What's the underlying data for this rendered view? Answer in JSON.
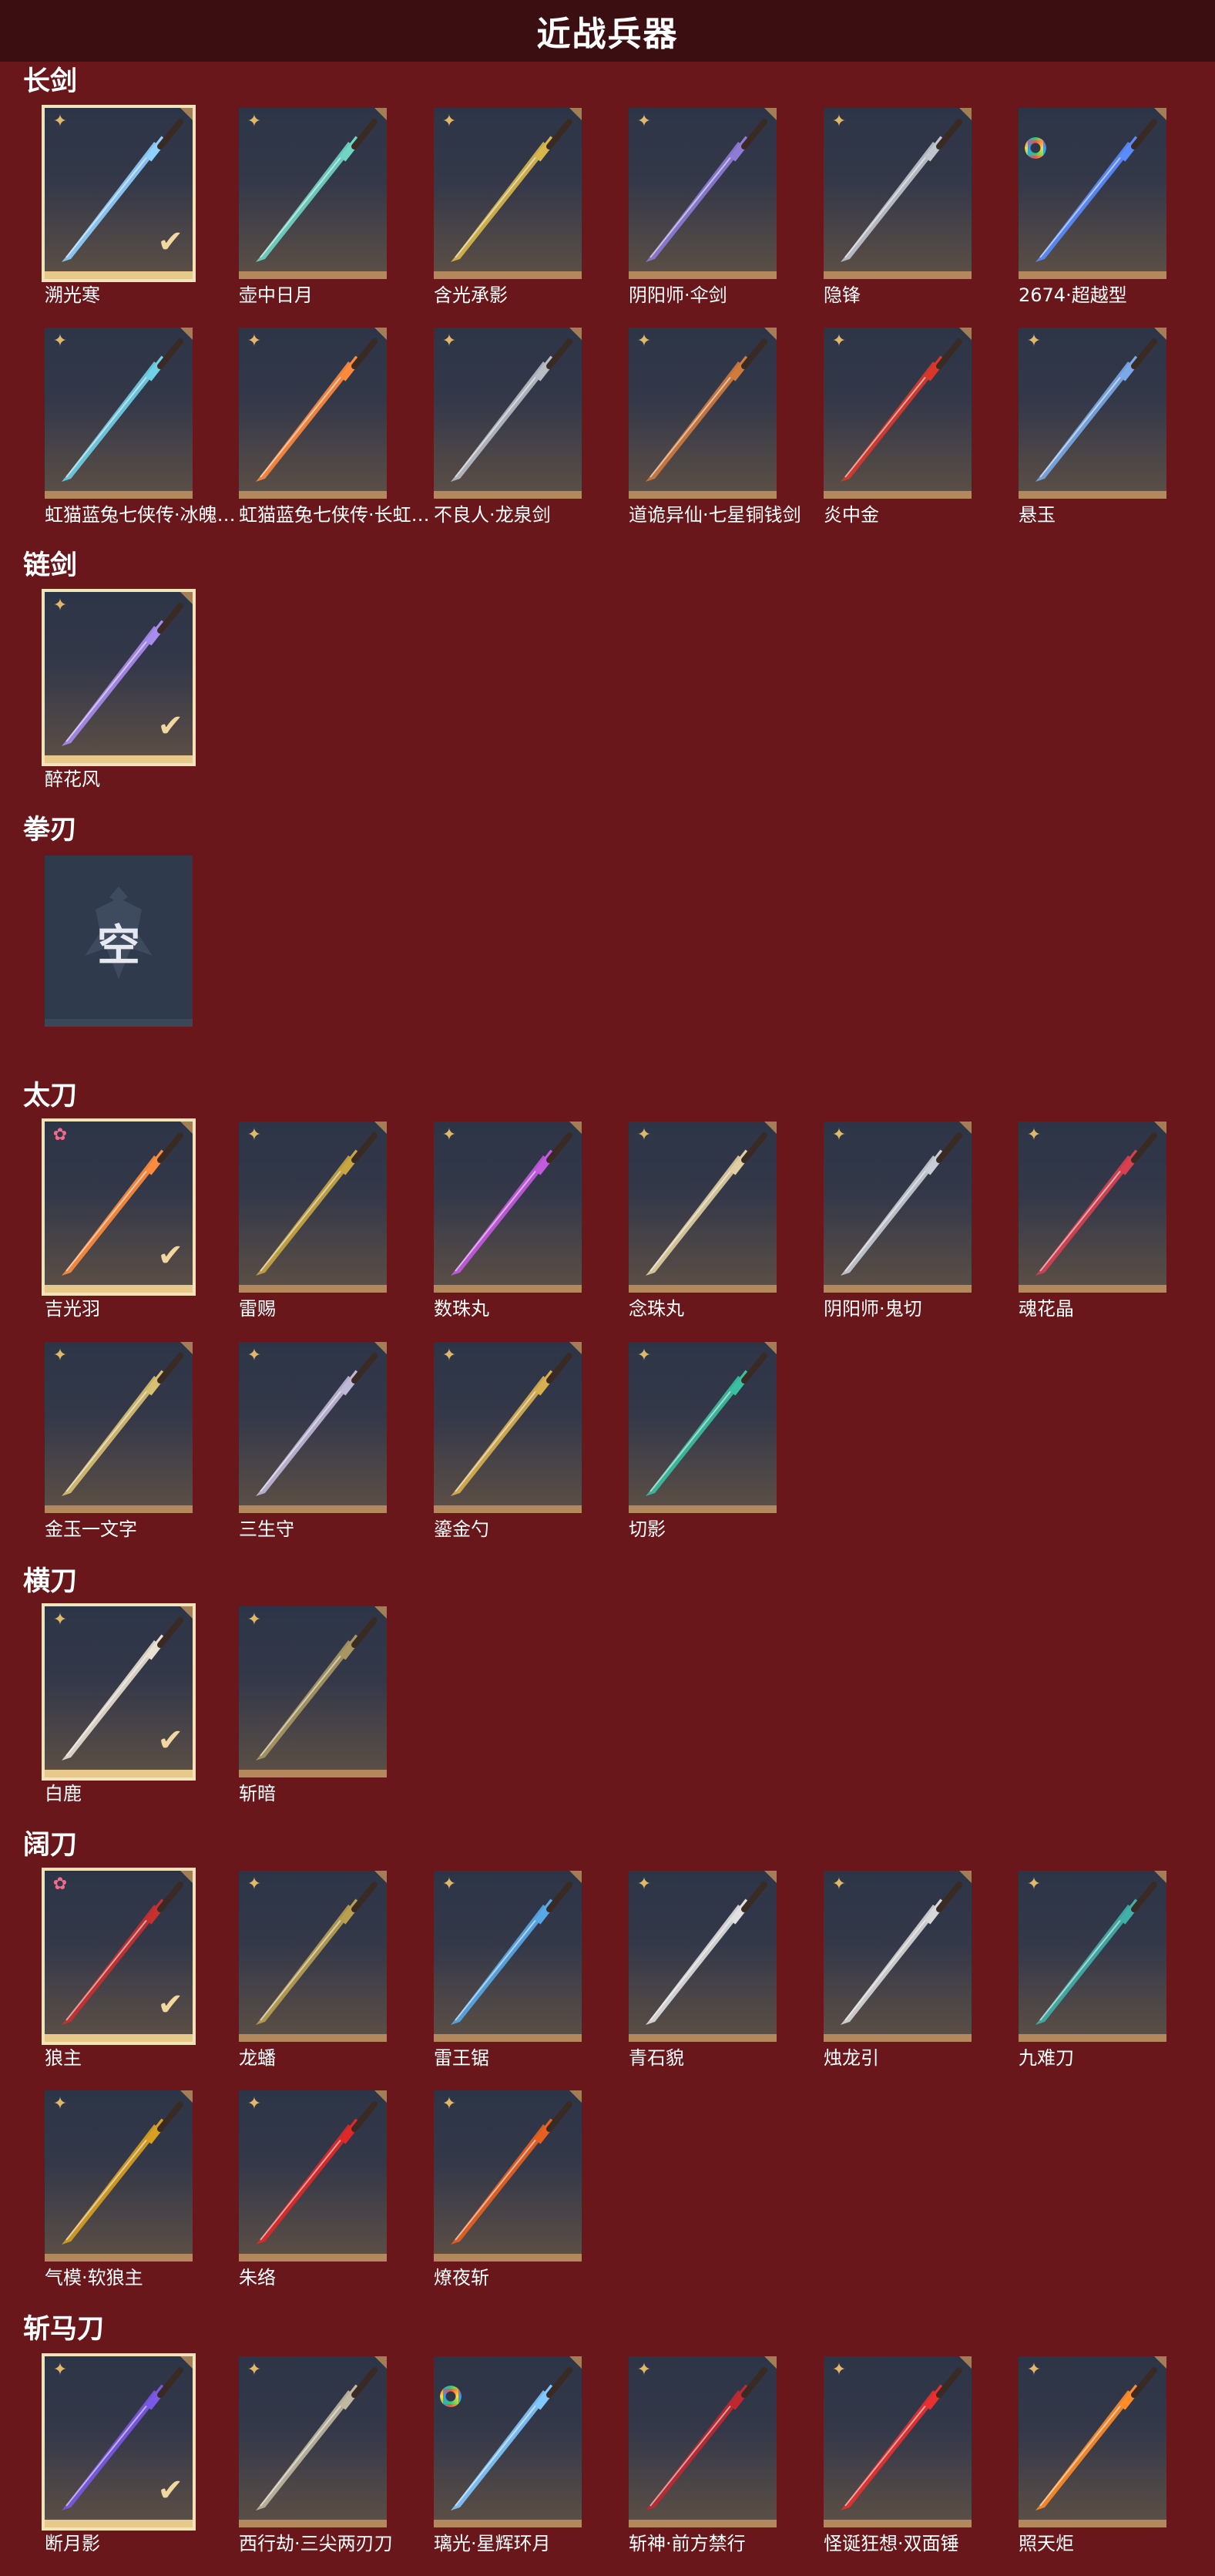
{
  "title": "近战兵器",
  "colors": {
    "background": "#6a171b",
    "title_bar": "#3b0e12",
    "tile_border": "#b3885c",
    "selected_border": "#f3e3b8"
  },
  "sections": [
    {
      "id": "changjian",
      "title": "长剑",
      "items": [
        {
          "label": "溯光寒",
          "badge": "gold-star-icon",
          "selected": true,
          "color": "#8fd0ff"
        },
        {
          "label": "壶中日月",
          "badge": "gold-star-icon",
          "selected": false,
          "color": "#6fd6c4"
        },
        {
          "label": "含光承影",
          "badge": "gold-star-icon",
          "selected": false,
          "color": "#d8b84a"
        },
        {
          "label": "阴阳师·伞剑",
          "badge": "gold-star-icon",
          "selected": false,
          "color": "#8d7bd6"
        },
        {
          "label": "隐锋",
          "badge": "gold-star-icon",
          "selected": false,
          "color": "#c0c4cc"
        },
        {
          "label": "2674·超越型",
          "badge": "rainbow-ring-icon",
          "selected": false,
          "color": "#5a8cff"
        },
        {
          "label": "虹猫蓝兔七侠传·冰魄…",
          "badge": "gold-star-icon",
          "selected": false,
          "color": "#6fd0e8"
        },
        {
          "label": "虹猫蓝兔七侠传·长虹…",
          "badge": "gold-star-icon",
          "selected": false,
          "color": "#ff8a3c"
        },
        {
          "label": "不良人·龙泉剑",
          "badge": "gold-star-icon",
          "selected": false,
          "color": "#b8bcc4"
        },
        {
          "label": "道诡异仙·七星铜钱剑",
          "badge": "gold-star-icon",
          "selected": false,
          "color": "#d07a3c"
        },
        {
          "label": "炎中金",
          "badge": "gold-star-icon",
          "selected": false,
          "color": "#d8382c"
        },
        {
          "label": "悬玉",
          "badge": "gold-star-icon",
          "selected": false,
          "color": "#7aa8e8"
        }
      ]
    },
    {
      "id": "lianjian",
      "title": "链剑",
      "items": [
        {
          "label": "醉花风",
          "badge": "gold-star-icon",
          "selected": true,
          "color": "#a88cf0"
        }
      ]
    },
    {
      "id": "quanren",
      "title": "拳刃",
      "items": [],
      "empty_text": "空"
    },
    {
      "id": "taidao",
      "title": "太刀",
      "items": [
        {
          "label": "吉光羽",
          "badge": "pink-star-icon",
          "selected": true,
          "color": "#ff8c3c"
        },
        {
          "label": "雷赐",
          "badge": "gold-star-icon",
          "selected": false,
          "color": "#c8a640"
        },
        {
          "label": "数珠丸",
          "badge": "gold-star-icon",
          "selected": false,
          "color": "#c45ae0"
        },
        {
          "label": "念珠丸",
          "badge": "gold-star-icon",
          "selected": false,
          "color": "#e0cfa0"
        },
        {
          "label": "阴阳师·鬼切",
          "badge": "gold-star-icon",
          "selected": false,
          "color": "#c8ccd4"
        },
        {
          "label": "魂花晶",
          "badge": "gold-star-icon",
          "selected": false,
          "color": "#d84050"
        },
        {
          "label": "金玉一文字",
          "badge": "gold-star-icon",
          "selected": false,
          "color": "#d8c070"
        },
        {
          "label": "三生守",
          "badge": "gold-star-icon",
          "selected": false,
          "color": "#c0b8d8"
        },
        {
          "label": "鎏金勺",
          "badge": "gold-star-icon",
          "selected": false,
          "color": "#d8b050"
        },
        {
          "label": "切影",
          "badge": "gold-star-icon",
          "selected": false,
          "color": "#3ac0a0"
        }
      ]
    },
    {
      "id": "hengdao",
      "title": "横刀",
      "items": [
        {
          "label": "白鹿",
          "badge": "gold-star-icon",
          "selected": true,
          "color": "#e8e0d0"
        },
        {
          "label": "斩暗",
          "badge": "gold-star-icon",
          "selected": false,
          "color": "#a89860"
        }
      ]
    },
    {
      "id": "kuodao",
      "title": "阔刀",
      "items": [
        {
          "label": "狼主",
          "badge": "pink-star-icon",
          "selected": true,
          "color": "#c83030"
        },
        {
          "label": "龙蟠",
          "badge": "gold-star-icon",
          "selected": false,
          "color": "#b8a050"
        },
        {
          "label": "雷王锯",
          "badge": "gold-star-icon",
          "selected": false,
          "color": "#58a8e8"
        },
        {
          "label": "青石貌",
          "badge": "gold-star-icon",
          "selected": false,
          "color": "#e0e0e0"
        },
        {
          "label": "烛龙引",
          "badge": "gold-star-icon",
          "selected": false,
          "color": "#d8d8d8"
        },
        {
          "label": "九难刀",
          "badge": "gold-star-icon",
          "selected": false,
          "color": "#40b0a8"
        },
        {
          "label": "气模·软狼主",
          "badge": "gold-star-icon",
          "selected": false,
          "color": "#d8a020"
        },
        {
          "label": "朱络",
          "badge": "gold-star-icon",
          "selected": false,
          "color": "#e02828"
        },
        {
          "label": "燎夜斩",
          "badge": "gold-star-icon",
          "selected": false,
          "color": "#e86020"
        }
      ]
    },
    {
      "id": "zhanmadao",
      "title": "斩马刀",
      "items": [
        {
          "label": "断月影",
          "badge": "gold-star-icon",
          "selected": true,
          "color": "#7a58e8"
        },
        {
          "label": "西行劫·三尖两刃刀",
          "badge": "gold-star-icon",
          "selected": false,
          "color": "#c0b8a0"
        },
        {
          "label": "璃光·星辉环月",
          "badge": "rainbow-ring-icon",
          "selected": false,
          "color": "#80c8ff"
        },
        {
          "label": "斩神·前方禁行",
          "badge": "gold-star-icon",
          "selected": false,
          "color": "#c02830"
        },
        {
          "label": "怪诞狂想·双面锤",
          "badge": "gold-star-icon",
          "selected": false,
          "color": "#e83030"
        },
        {
          "label": "照天炬",
          "badge": "gold-star-icon",
          "selected": false,
          "color": "#ff8c28"
        }
      ]
    }
  ]
}
